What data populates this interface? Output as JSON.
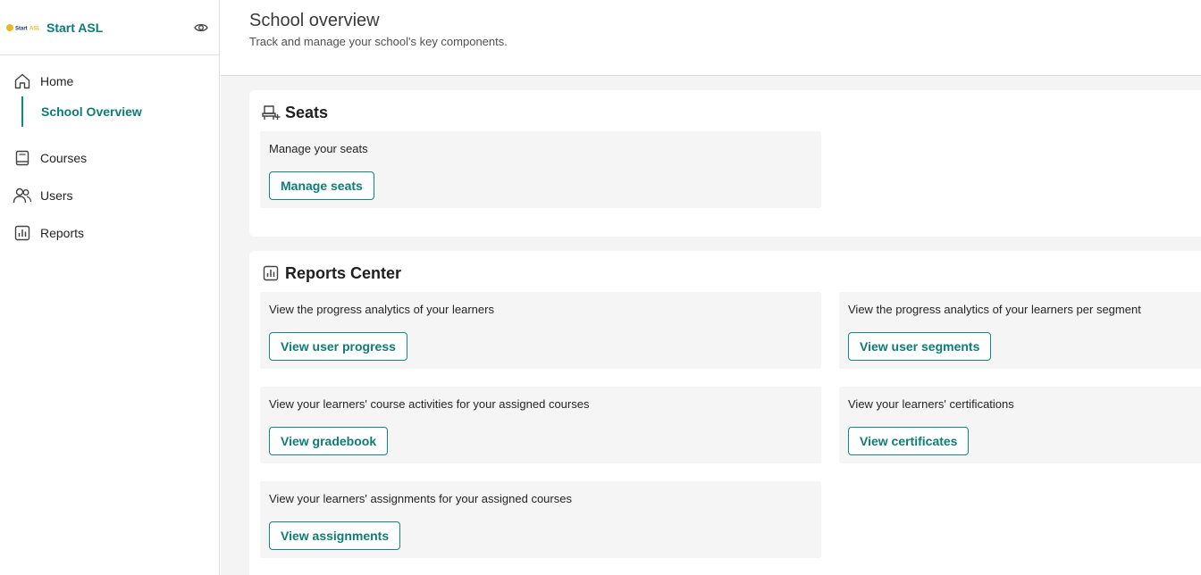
{
  "brand": {
    "name": "Start ASL",
    "logo_text": "StartASL"
  },
  "sidebar": {
    "items": [
      {
        "label": "Home",
        "icon": "home-icon"
      },
      {
        "label": "School Overview",
        "icon": ""
      },
      {
        "label": "Courses",
        "icon": "book-icon"
      },
      {
        "label": "Users",
        "icon": "users-icon"
      },
      {
        "label": "Reports",
        "icon": "chart-icon"
      }
    ]
  },
  "header": {
    "title": "School overview",
    "subtitle": "Track and manage your school's key components."
  },
  "seats": {
    "title": "Seats",
    "tiles": [
      {
        "text": "Manage your seats",
        "button": "Manage seats"
      }
    ]
  },
  "reports": {
    "title": "Reports Center",
    "tiles": [
      {
        "text": "View the progress analytics of your learners",
        "button": "View user progress"
      },
      {
        "text": "View the progress analytics of your learners per segment",
        "button": "View user segments"
      },
      {
        "text": "View your learners' course activities for your assigned courses",
        "button": "View gradebook"
      },
      {
        "text": "View your learners' certifications",
        "button": "View certificates"
      },
      {
        "text": "View your learners' assignments for your assigned courses",
        "button": "View assignments"
      }
    ]
  },
  "colors": {
    "accent": "#0e8a80",
    "accent_text": "#0e7c74",
    "background": "#f4f4f4"
  }
}
